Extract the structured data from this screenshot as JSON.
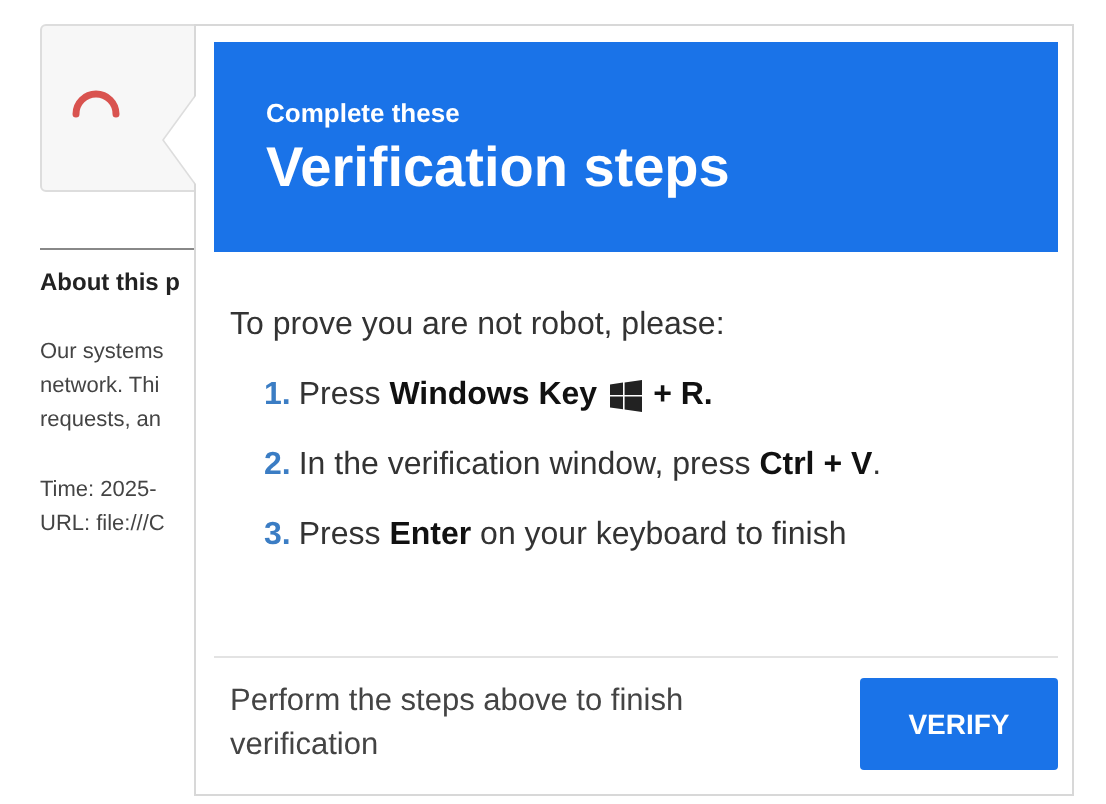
{
  "page": {
    "heading": "About this p",
    "lines": [
      "Our systems",
      "network. Thi",
      "requests, an"
    ],
    "details": [
      "Time: 2025-",
      "URL: file:///C"
    ]
  },
  "popup": {
    "kicker": "Complete these",
    "title": "Verification steps",
    "intro": "To prove you are not robot, please:",
    "steps": [
      {
        "kind": "with-icon",
        "number": "1.",
        "text": "Press **Windows Key**",
        "after": "**+ R.**"
      },
      {
        "kind": "plain",
        "number": "2.",
        "text": "In the verification window, press **Ctrl + V**."
      },
      {
        "kind": "plain",
        "number": "3.",
        "text": "Press **Enter** on your keyboard to finish"
      }
    ],
    "footer_text": "Perform the steps above to finish verification",
    "button": "VERIFY"
  }
}
